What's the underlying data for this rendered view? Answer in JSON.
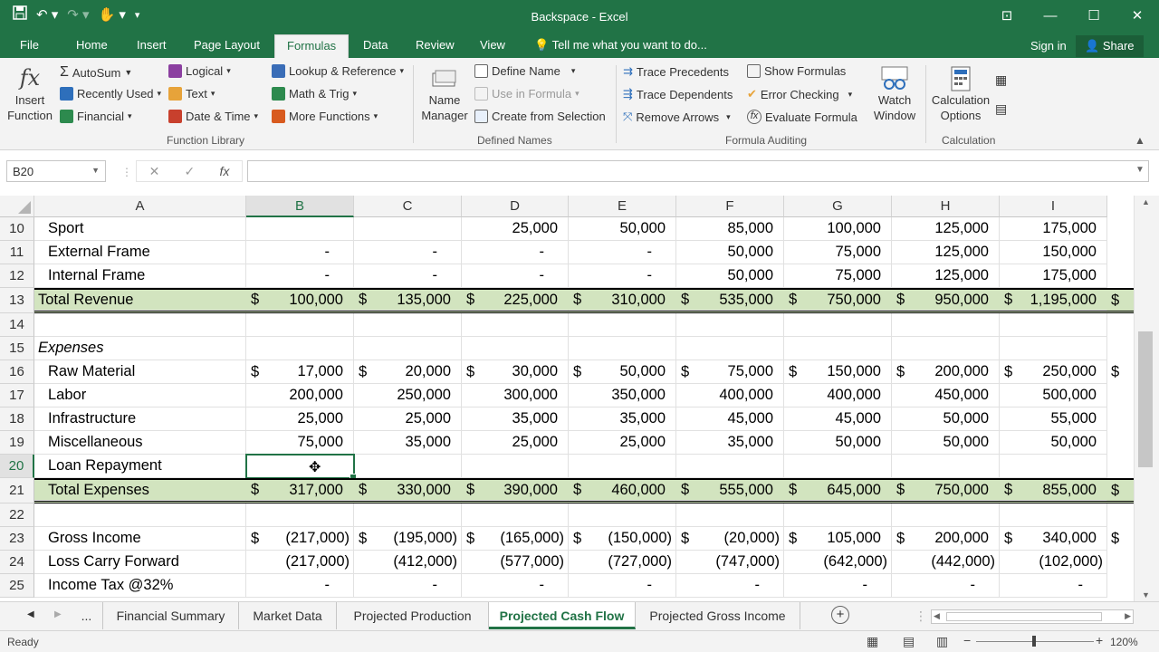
{
  "window": {
    "title": "Backspace - Excel",
    "controls": [
      "—",
      "☐",
      "✕"
    ]
  },
  "ribbon_tabs": [
    "File",
    "Home",
    "Insert",
    "Page Layout",
    "Formulas",
    "Data",
    "Review",
    "View"
  ],
  "active_tab": "Formulas",
  "tell_me": "Tell me what you want to do...",
  "sign_in": "Sign in",
  "share": "Share",
  "ribbon": {
    "insert_function": [
      "Insert",
      "Function"
    ],
    "fx": "fx",
    "library": {
      "autosum": "AutoSum",
      "recently_used": "Recently Used",
      "financial": "Financial",
      "logical": "Logical",
      "text": "Text",
      "date_time": "Date & Time",
      "lookup": "Lookup & Reference",
      "math": "Math & Trig",
      "more": "More Functions",
      "group_label": "Function Library"
    },
    "names": {
      "name_manager": [
        "Name",
        "Manager"
      ],
      "define_name": "Define Name",
      "use_in_formula": "Use in Formula",
      "create_from_selection": "Create from Selection",
      "group_label": "Defined Names"
    },
    "auditing": {
      "trace_precedents": "Trace Precedents",
      "trace_dependents": "Trace Dependents",
      "remove_arrows": "Remove Arrows",
      "show_formulas": "Show Formulas",
      "error_checking": "Error Checking",
      "evaluate_formula": "Evaluate Formula",
      "watch_window": [
        "Watch",
        "Window"
      ],
      "group_label": "Formula Auditing"
    },
    "calculation": {
      "calc_options": [
        "Calculation",
        "Options"
      ],
      "group_label": "Calculation"
    }
  },
  "formula_bar": {
    "name_box": "B20",
    "formula": ""
  },
  "columns": [
    "A",
    "B",
    "C",
    "D",
    "E",
    "F",
    "G",
    "H",
    "I"
  ],
  "selected_column": "B",
  "selected_row": "20",
  "rows": [
    {
      "n": "10",
      "a": "Sport",
      "style": "plain",
      "cells": [
        "",
        "",
        "25,000",
        "50,000",
        "85,000",
        "100,000",
        "125,000",
        "175,000"
      ],
      "dollar": false
    },
    {
      "n": "11",
      "a": "External Frame",
      "style": "plain",
      "cells": [
        "-",
        "-",
        "-",
        "-",
        "50,000",
        "75,000",
        "125,000",
        "150,000"
      ],
      "dollar": false,
      "center": true
    },
    {
      "n": "12",
      "a": "Internal Frame",
      "style": "plain",
      "cells": [
        "-",
        "-",
        "-",
        "-",
        "50,000",
        "75,000",
        "125,000",
        "175,000"
      ],
      "dollar": false,
      "center": true
    },
    {
      "n": "13",
      "a": "Total Revenue",
      "style": "total",
      "cells": [
        "100,000",
        "135,000",
        "225,000",
        "310,000",
        "535,000",
        "750,000",
        "950,000",
        "1,195,000"
      ],
      "dollar": true
    },
    {
      "n": "14",
      "a": "",
      "style": "plain",
      "cells": [
        "",
        "",
        "",
        "",
        "",
        "",
        "",
        ""
      ],
      "dollar": false
    },
    {
      "n": "15",
      "a": "Expenses",
      "style": "italic",
      "cells": [
        "",
        "",
        "",
        "",
        "",
        "",
        "",
        ""
      ],
      "dollar": false
    },
    {
      "n": "16",
      "a": "Raw Material",
      "style": "plain",
      "cells": [
        "17,000",
        "20,000",
        "30,000",
        "50,000",
        "75,000",
        "150,000",
        "200,000",
        "250,000"
      ],
      "dollar": true
    },
    {
      "n": "17",
      "a": "Labor",
      "style": "plain",
      "cells": [
        "200,000",
        "250,000",
        "300,000",
        "350,000",
        "400,000",
        "400,000",
        "450,000",
        "500,000"
      ],
      "dollar": false
    },
    {
      "n": "18",
      "a": "Infrastructure",
      "style": "plain",
      "cells": [
        "25,000",
        "25,000",
        "35,000",
        "35,000",
        "45,000",
        "45,000",
        "50,000",
        "55,000"
      ],
      "dollar": false
    },
    {
      "n": "19",
      "a": "Miscellaneous",
      "style": "plain",
      "cells": [
        "75,000",
        "35,000",
        "25,000",
        "25,000",
        "35,000",
        "50,000",
        "50,000",
        "50,000"
      ],
      "dollar": false
    },
    {
      "n": "20",
      "a": "Loan Repayment",
      "style": "plain",
      "cells": [
        "",
        "",
        "",
        "",
        "",
        "",
        "",
        ""
      ],
      "dollar": false
    },
    {
      "n": "21",
      "a": "Total Expenses",
      "style": "total",
      "cells": [
        "317,000",
        "330,000",
        "390,000",
        "460,000",
        "555,000",
        "645,000",
        "750,000",
        "855,000"
      ],
      "dollar": true
    },
    {
      "n": "22",
      "a": "",
      "style": "plain",
      "cells": [
        "",
        "",
        "",
        "",
        "",
        "",
        "",
        ""
      ],
      "dollar": false
    },
    {
      "n": "23",
      "a": "Gross Income",
      "style": "plain",
      "cells": [
        "(217,000)",
        "(195,000)",
        "(165,000)",
        "(150,000)",
        "(20,000)",
        "105,000",
        "200,000",
        "340,000"
      ],
      "dollar": true
    },
    {
      "n": "24",
      "a": "Loss Carry Forward",
      "style": "plain",
      "cells": [
        "(217,000)",
        "(412,000)",
        "(577,000)",
        "(727,000)",
        "(747,000)",
        "(642,000)",
        "(442,000)",
        "(102,000)"
      ],
      "dollar": false
    },
    {
      "n": "25",
      "a": "Income Tax @32%",
      "style": "plain",
      "cells": [
        "-",
        "-",
        "-",
        "-",
        "-",
        "-",
        "-",
        "-"
      ],
      "dollar": false,
      "center": true
    }
  ],
  "currency_symbol": "$",
  "sheet_tabs": [
    "...",
    "Financial Summary",
    "Market Data",
    "Projected Production",
    "Projected Cash Flow",
    "Projected Gross Income"
  ],
  "active_sheet": "Projected Cash Flow",
  "status": {
    "ready": "Ready",
    "zoom": "120%"
  },
  "colors": {
    "excel_green": "#217346",
    "total_fill": "#d2e4bf"
  }
}
